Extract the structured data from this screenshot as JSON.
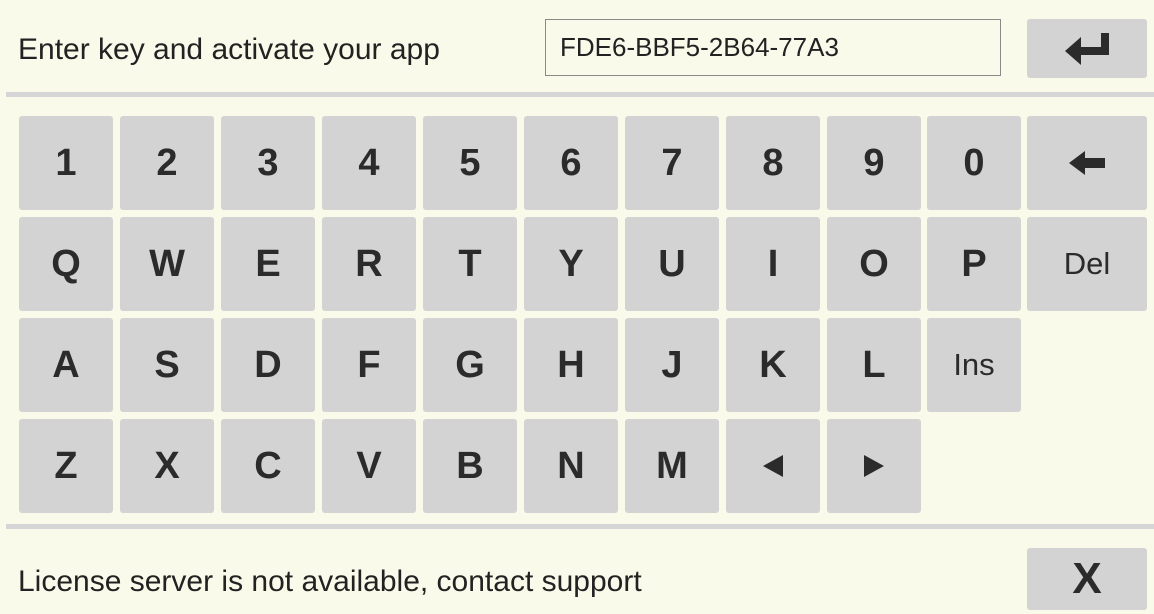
{
  "prompt": "Enter key and activate your app",
  "license_key": "FDE6-BBF5-2B64-77A3",
  "enter_button": {
    "icon": "enter-return-icon"
  },
  "keyboard": {
    "row1": [
      "1",
      "2",
      "3",
      "4",
      "5",
      "6",
      "7",
      "8",
      "9",
      "0"
    ],
    "row2": [
      "Q",
      "W",
      "E",
      "R",
      "T",
      "Y",
      "U",
      "I",
      "O",
      "P"
    ],
    "row3": [
      "A",
      "S",
      "D",
      "F",
      "G",
      "H",
      "J",
      "K",
      "L"
    ],
    "row4": [
      "Z",
      "X",
      "C",
      "V",
      "B",
      "N",
      "M"
    ],
    "del_label": "Del",
    "ins_label": "Ins",
    "backspace_icon": "backspace-arrow-icon",
    "cursor_left_icon": "triangle-left-icon",
    "cursor_right_icon": "triangle-right-icon"
  },
  "status_message": "License server is not available, contact support",
  "close_label": "X",
  "colors": {
    "background": "#fafaea",
    "key": "#d3d3d3",
    "key_text": "#2b2b2b",
    "divider": "#d6d6d6"
  }
}
